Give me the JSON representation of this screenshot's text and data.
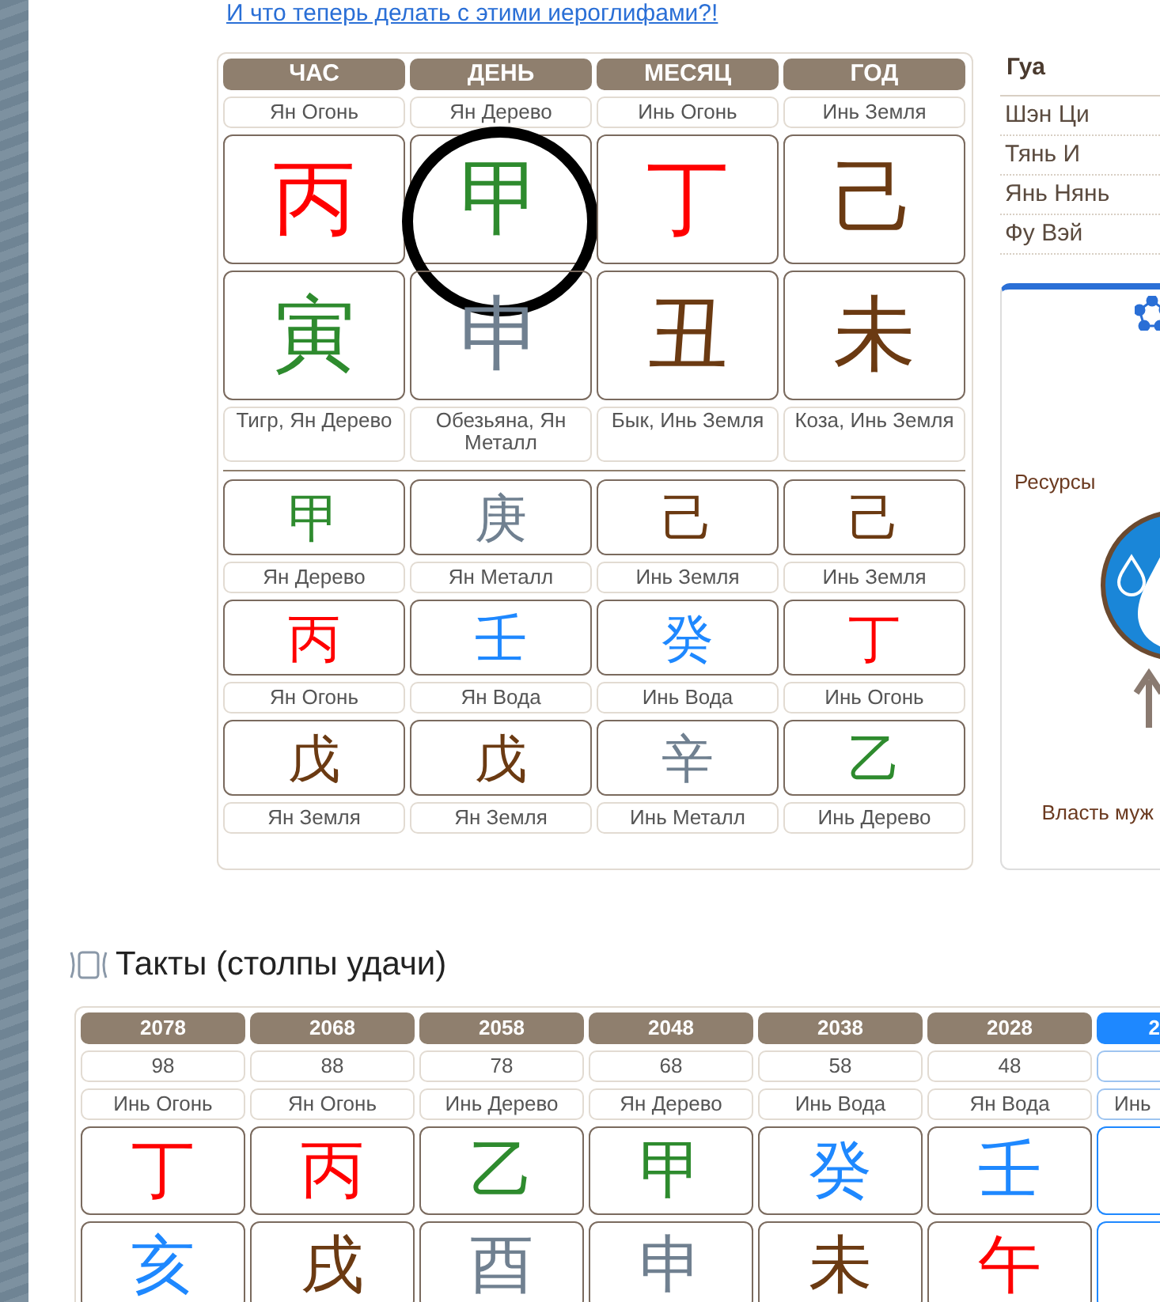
{
  "top_link": "И что теперь делать с этими иероглифами?!",
  "natal_chart": {
    "pillars": [
      {
        "header": "ЧАС",
        "element": "Ян Огонь",
        "stem": {
          "char": "丙",
          "color": "#ff0000",
          "circled": false
        },
        "branch": {
          "char": "寅",
          "color": "#2e8b2e"
        },
        "branch_label": "Тигр, Ян Дерево",
        "hidden": [
          {
            "char": "甲",
            "color": "#2e8b2e",
            "label": "Ян Дерево"
          },
          {
            "char": "丙",
            "color": "#ff0000",
            "label": "Ян Огонь"
          },
          {
            "char": "戊",
            "color": "#6b3a12",
            "label": "Ян Земля"
          }
        ]
      },
      {
        "header": "ДЕНЬ",
        "element": "Ян Дерево",
        "stem": {
          "char": "甲",
          "color": "#2e8b2e",
          "circled": true
        },
        "branch": {
          "char": "申",
          "color": "#708090"
        },
        "branch_label": "Обезьяна, Ян Металл",
        "hidden": [
          {
            "char": "庚",
            "color": "#708090",
            "label": "Ян Металл"
          },
          {
            "char": "壬",
            "color": "#1e88ff",
            "label": "Ян Вода"
          },
          {
            "char": "戊",
            "color": "#6b3a12",
            "label": "Ян Земля"
          }
        ]
      },
      {
        "header": "МЕСЯЦ",
        "element": "Инь Огонь",
        "stem": {
          "char": "丁",
          "color": "#ff0000",
          "circled": false
        },
        "branch": {
          "char": "丑",
          "color": "#6b3a12"
        },
        "branch_label": "Бык, Инь Земля",
        "hidden": [
          {
            "char": "己",
            "color": "#6b3a12",
            "label": "Инь Земля"
          },
          {
            "char": "癸",
            "color": "#1e88ff",
            "label": "Инь Вода"
          },
          {
            "char": "辛",
            "color": "#708090",
            "label": "Инь Металл"
          }
        ]
      },
      {
        "header": "ГОД",
        "element": "Инь Земля",
        "stem": {
          "char": "己",
          "color": "#6b3a12",
          "circled": false
        },
        "branch": {
          "char": "未",
          "color": "#6b3a12"
        },
        "branch_label": "Коза, Инь Земля",
        "hidden": [
          {
            "char": "己",
            "color": "#6b3a12",
            "label": "Инь Земля"
          },
          {
            "char": "丁",
            "color": "#ff0000",
            "label": "Инь Огонь"
          },
          {
            "char": "乙",
            "color": "#2e8b2e",
            "label": "Инь Дерево"
          }
        ]
      }
    ]
  },
  "gua": {
    "title": "Гуа",
    "items": [
      "Шэн Ци",
      "Тянь И",
      "Янь Нянь",
      "Фу Вэй"
    ]
  },
  "diagram_card": {
    "labels": [
      "Ресурсы",
      "Власть муж"
    ]
  },
  "luck_pillars": {
    "title": "Такты (столпы удачи)",
    "items": [
      {
        "year": "2078",
        "age": "98",
        "element": "Инь Огонь",
        "stem": {
          "char": "丁",
          "color": "#ff0000"
        },
        "branch": {
          "char": "亥",
          "color": "#1e88ff"
        },
        "selected": false
      },
      {
        "year": "2068",
        "age": "88",
        "element": "Ян Огонь",
        "stem": {
          "char": "丙",
          "color": "#ff0000"
        },
        "branch": {
          "char": "戌",
          "color": "#6b3a12"
        },
        "selected": false
      },
      {
        "year": "2058",
        "age": "78",
        "element": "Инь Дерево",
        "stem": {
          "char": "乙",
          "color": "#2e8b2e"
        },
        "branch": {
          "char": "酉",
          "color": "#708090"
        },
        "selected": false
      },
      {
        "year": "2048",
        "age": "68",
        "element": "Ян Дерево",
        "stem": {
          "char": "甲",
          "color": "#2e8b2e"
        },
        "branch": {
          "char": "申",
          "color": "#708090"
        },
        "selected": false
      },
      {
        "year": "2038",
        "age": "58",
        "element": "Инь Вода",
        "stem": {
          "char": "癸",
          "color": "#1e88ff"
        },
        "branch": {
          "char": "未",
          "color": "#6b3a12"
        },
        "selected": false
      },
      {
        "year": "2028",
        "age": "48",
        "element": "Ян Вода",
        "stem": {
          "char": "壬",
          "color": "#1e88ff"
        },
        "branch": {
          "char": "午",
          "color": "#ff0000"
        },
        "selected": false
      },
      {
        "year": "2",
        "element": "Инь",
        "selected": true
      }
    ]
  }
}
